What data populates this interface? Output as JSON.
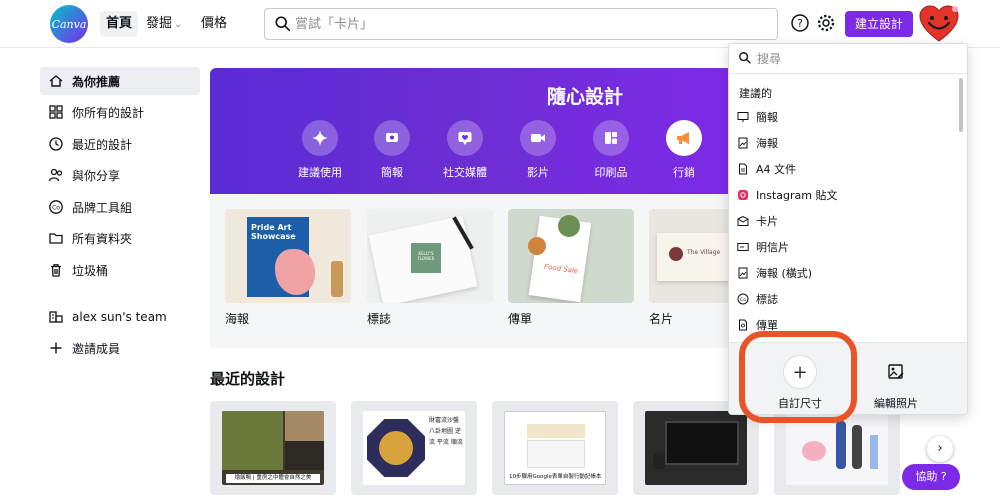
{
  "header": {
    "logo": "Canva",
    "nav": {
      "home": "首頁",
      "discover": "發掘",
      "pricing": "價格"
    },
    "search": {
      "placeholder": "嘗試「卡片」",
      "value": ""
    },
    "create_button": "建立設計",
    "icons": {
      "search": "search-icon",
      "help": "help-icon",
      "settings": "gear-icon",
      "avatar": "heart-face-avatar"
    },
    "accent_color": "#7d2ae8"
  },
  "sidebar": {
    "items": [
      {
        "label": "為你推薦",
        "icon": "home-icon",
        "active": true
      },
      {
        "label": "你所有的設計",
        "icon": "grid-icon"
      },
      {
        "label": "最近的設計",
        "icon": "clock-icon"
      },
      {
        "label": "與你分享",
        "icon": "share-people-icon"
      },
      {
        "label": "品牌工具組",
        "icon": "brand-kit-icon"
      },
      {
        "label": "所有資料夾",
        "icon": "folder-icon"
      },
      {
        "label": "垃圾桶",
        "icon": "trash-icon"
      },
      {
        "label": "alex sun's team",
        "icon": "team-icon"
      },
      {
        "label": "邀請成員",
        "icon": "plus-icon"
      }
    ]
  },
  "banner": {
    "title": "隨心設計",
    "categories": [
      {
        "label": "建議使用",
        "icon": "sparkle-icon"
      },
      {
        "label": "簡報",
        "icon": "presentation-icon"
      },
      {
        "label": "社交媒體",
        "icon": "heart-chat-icon"
      },
      {
        "label": "影片",
        "icon": "video-icon"
      },
      {
        "label": "印刷品",
        "icon": "print-icon"
      },
      {
        "label": "行銷",
        "icon": "megaphone-icon",
        "active": true
      }
    ]
  },
  "templates": [
    {
      "label": "海報",
      "text": "Pride Art Showcase"
    },
    {
      "label": "標誌",
      "text": "KELLY'S FLOWER"
    },
    {
      "label": "傳單",
      "text": "Food Sale"
    },
    {
      "label": "名片",
      "text": "The Village"
    }
  ],
  "recent": {
    "title": "最近的設計",
    "items": [
      {
        "caption": "燴飯鴨 | 重房之中體會自然之美"
      },
      {
        "caption": "財富流沙盤 八卦地圖 逆流 平流 順流"
      },
      {
        "caption": "10步驟用Google表單自製行動記帳本"
      },
      {
        "caption": ""
      },
      {
        "caption": ""
      }
    ]
  },
  "dropdown": {
    "search_placeholder": "搜尋",
    "heading": "建議的",
    "items": [
      {
        "label": "簡報",
        "icon": "presentation-icon"
      },
      {
        "label": "海報",
        "icon": "poster-icon"
      },
      {
        "label": "A4 文件",
        "icon": "document-icon"
      },
      {
        "label": "Instagram 貼文",
        "icon": "instagram-icon"
      },
      {
        "label": "卡片",
        "icon": "card-icon"
      },
      {
        "label": "明信片",
        "icon": "postcard-icon"
      },
      {
        "label": "海報 (橫式)",
        "icon": "poster-landscape-icon"
      },
      {
        "label": "標誌",
        "icon": "logo-icon"
      },
      {
        "label": "傳單",
        "icon": "flyer-icon"
      }
    ],
    "footer": {
      "custom_size": "自訂尺寸",
      "edit_photo": "編輯照片"
    }
  },
  "assist_button": "協助 ?"
}
